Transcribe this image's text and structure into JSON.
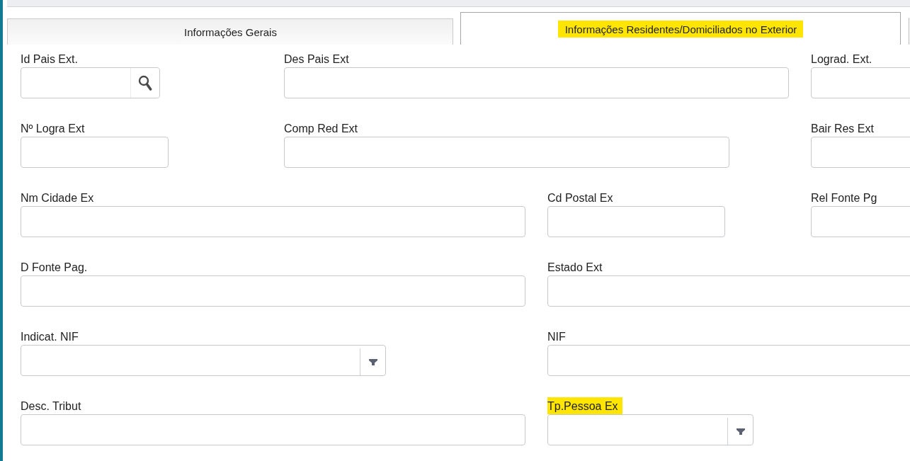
{
  "tabs": [
    {
      "label": "Informações Gerais",
      "selected": false,
      "highlighted": false
    },
    {
      "label": "Informações Residentes/Domiciliados no Exterior",
      "selected": true,
      "highlighted": true
    }
  ],
  "form": {
    "rows": [
      [
        {
          "label": "Id Pais Ext.",
          "kind": "lookup",
          "highlighted": false
        },
        {
          "label": "Des Pais Ext",
          "kind": "text",
          "highlighted": false
        },
        {
          "label": "Lograd. Ext.",
          "kind": "text",
          "highlighted": false
        }
      ],
      [
        {
          "label": "Nº Logra Ext",
          "kind": "text",
          "highlighted": false
        },
        {
          "label": "Comp Red Ext",
          "kind": "text",
          "highlighted": false
        },
        {
          "label": "Bair Res Ext",
          "kind": "text",
          "highlighted": false
        }
      ],
      [
        {
          "label": "Nm Cidade Ex",
          "kind": "text",
          "highlighted": false
        },
        {
          "label": "Cd Postal Ex",
          "kind": "text",
          "highlighted": false
        },
        {
          "label": "Rel Fonte Pg",
          "kind": "text",
          "highlighted": false
        }
      ],
      [
        {
          "label": "D Fonte Pag.",
          "kind": "text",
          "highlighted": false
        },
        {
          "label": "Estado Ext",
          "kind": "text",
          "highlighted": false
        }
      ],
      [
        {
          "label": "Indicat. NIF",
          "kind": "select",
          "highlighted": false
        },
        {
          "label": "NIF",
          "kind": "text",
          "highlighted": false
        }
      ],
      [
        {
          "label": "Desc. Tribut",
          "kind": "text",
          "highlighted": false
        },
        {
          "label": "Tp.Pessoa Ex",
          "kind": "select",
          "highlighted": true
        }
      ]
    ]
  }
}
